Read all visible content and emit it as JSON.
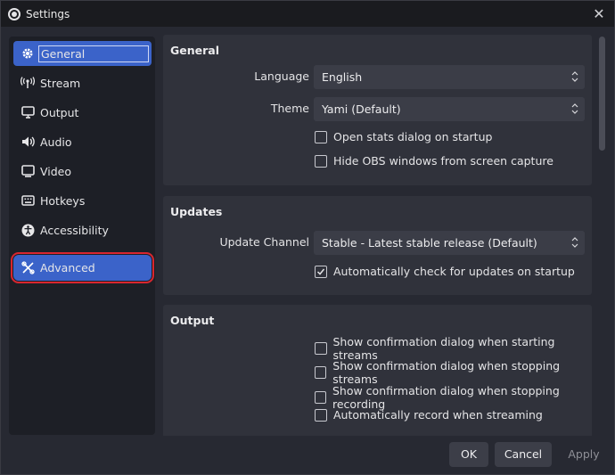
{
  "window": {
    "title": "Settings",
    "close": "✕"
  },
  "sidebar": {
    "items": [
      {
        "label": "General",
        "icon": "gear-icon"
      },
      {
        "label": "Stream",
        "icon": "antenna-icon"
      },
      {
        "label": "Output",
        "icon": "monitor-icon"
      },
      {
        "label": "Audio",
        "icon": "speaker-icon"
      },
      {
        "label": "Video",
        "icon": "display-icon"
      },
      {
        "label": "Hotkeys",
        "icon": "keyboard-icon"
      },
      {
        "label": "Accessibility",
        "icon": "accessibility-icon"
      },
      {
        "label": "Advanced",
        "icon": "tools-icon"
      }
    ]
  },
  "general": {
    "title": "General",
    "language_label": "Language",
    "language_value": "English",
    "theme_label": "Theme",
    "theme_value": "Yami (Default)",
    "open_stats_label": "Open stats dialog on startup",
    "open_stats_checked": false,
    "hide_windows_label": "Hide OBS windows from screen capture",
    "hide_windows_checked": false
  },
  "updates": {
    "title": "Updates",
    "channel_label": "Update Channel",
    "channel_value": "Stable - Latest stable release (Default)",
    "auto_check_label": "Automatically check for updates on startup",
    "auto_check_checked": true
  },
  "output": {
    "title": "Output",
    "items": [
      {
        "label": "Show confirmation dialog when starting streams",
        "checked": false
      },
      {
        "label": "Show confirmation dialog when stopping streams",
        "checked": false
      },
      {
        "label": "Show confirmation dialog when stopping recording",
        "checked": false
      },
      {
        "label": "Automatically record when streaming",
        "checked": false
      }
    ]
  },
  "buttons": {
    "ok": "OK",
    "cancel": "Cancel",
    "apply": "Apply"
  },
  "colors": {
    "accent": "#3b63c9",
    "highlight": "#d8262f",
    "panel": "#30323b"
  }
}
